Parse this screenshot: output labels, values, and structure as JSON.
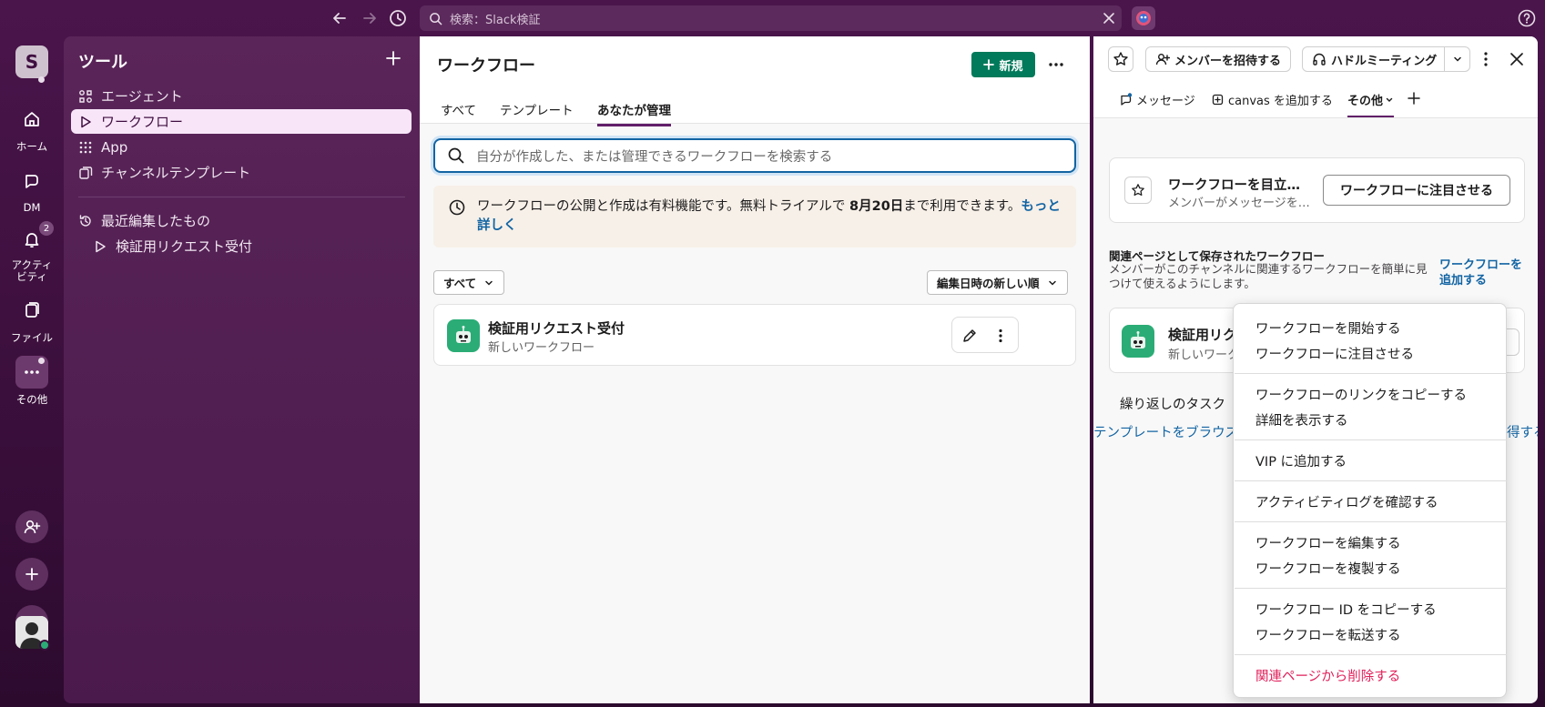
{
  "topbar": {
    "search_text": "検索：Slack検証"
  },
  "rail": {
    "workspace_initial": "S",
    "items": [
      {
        "label": "ホーム",
        "icon": "home-icon"
      },
      {
        "label": "DM",
        "icon": "dm-icon"
      },
      {
        "label": "アクティビティ",
        "icon": "bell-icon",
        "badge": "2"
      },
      {
        "label": "ファイル",
        "icon": "files-icon"
      },
      {
        "label": "その他",
        "icon": "more-icon"
      }
    ]
  },
  "sidebar": {
    "title": "ツール",
    "items": [
      {
        "label": "エージェント",
        "icon": "agent-icon"
      },
      {
        "label": "ワークフロー",
        "icon": "workflow-icon",
        "selected": true
      },
      {
        "label": "App",
        "icon": "apps-grid-icon"
      },
      {
        "label": "チャンネルテンプレート",
        "icon": "template-icon"
      }
    ],
    "recent_label": "最近編集したもの",
    "recent_items": [
      {
        "label": "検証用リクエスト受付"
      }
    ]
  },
  "main": {
    "title": "ワークフロー",
    "new_button": "新規",
    "tabs": [
      {
        "label": "すべて"
      },
      {
        "label": "テンプレート"
      },
      {
        "label": "あなたが管理",
        "active": true
      }
    ],
    "search_placeholder": "自分が作成した、または管理できるワークフローを検索する",
    "notice": {
      "text_before": "ワークフローの公開と作成は有料機能です。無料トライアルで ",
      "date": "8月20日",
      "text_after": "まで利用できます。",
      "link": "もっと詳しく"
    },
    "filter_all": "すべて",
    "sort_label": "編集日時の新しい順",
    "workflows": [
      {
        "title": "検証用リクエスト受付",
        "subtitle": "新しいワークフロー"
      }
    ]
  },
  "panel": {
    "invite_button": "メンバーを招待する",
    "huddle_button": "ハドルミーティング",
    "tabs": [
      {
        "label": "メッセージ",
        "icon": "message-icon"
      },
      {
        "label": "canvas を追加する",
        "icon": "canvas-icon"
      },
      {
        "label": "その他",
        "active": true
      }
    ],
    "feature_card": {
      "title": "ワークフローを目立…",
      "subtitle": "メンバーがメッセージを…",
      "button": "ワークフローに注目させる"
    },
    "bookmarked_title": "関連ページとして保存されたワークフロー",
    "bookmarked_desc": "メンバーがこのチャンネルに関連するワークフローを簡単に見つけて使えるようにします。",
    "add_workflow_link": "ワークフローを追加する",
    "workflow_card": {
      "title": "検証用リク",
      "subtitle": "新しいワーク"
    },
    "repeat_text": "繰り返しのタスク",
    "browse_link": "テンプレートをブラウズ",
    "get_link": "得する"
  },
  "menu": {
    "items": [
      {
        "label": "ワークフローを開始する"
      },
      {
        "label": "ワークフローに注目させる"
      },
      {
        "label": "ワークフローのリンクをコピーする"
      },
      {
        "label": "詳細を表示する"
      },
      {
        "label": "VIP に追加する"
      },
      {
        "label": "アクティビティログを確認する"
      },
      {
        "label": "ワークフローを編集する"
      },
      {
        "label": "ワークフローを複製する"
      },
      {
        "label": "ワークフロー ID をコピーする"
      },
      {
        "label": "ワークフローを転送する"
      },
      {
        "label": "関連ページから削除する",
        "danger": true
      }
    ]
  },
  "colors": {
    "aubergine": "#4a154b",
    "accent_green": "#007a5a",
    "link_blue": "#1264a3",
    "danger_red": "#e01e5a"
  }
}
